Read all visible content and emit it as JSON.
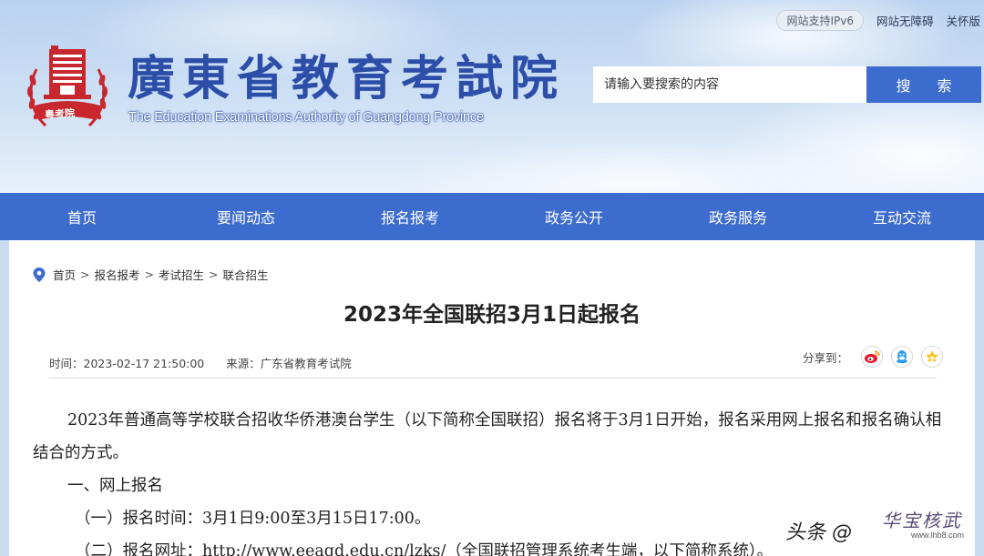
{
  "header": {
    "seal_text": "粤考院",
    "title": "廣東省教育考試院",
    "subtitle": "The Education Examinations Authority of Guangdong Province",
    "ipv6_badge": "网站支持IPv6",
    "accessibility_link": "网站无障碍",
    "elderly_link": "关怀版",
    "search": {
      "placeholder": "请输入要搜索的内容",
      "button": "搜 索"
    }
  },
  "nav": {
    "items": [
      {
        "label": "首页"
      },
      {
        "label": "要闻动态"
      },
      {
        "label": "报名报考"
      },
      {
        "label": "政务公开"
      },
      {
        "label": "政务服务"
      },
      {
        "label": "互动交流"
      }
    ]
  },
  "breadcrumb": {
    "items": [
      "首页",
      "报名报考",
      "考试招生",
      "联合招生"
    ],
    "separator": ">"
  },
  "article": {
    "title": "2023年全国联招3月1日起报名",
    "time": "时间：2023-02-17 21:50:00",
    "source": "来源：广东省教育考试院",
    "share_label": "分享到：",
    "share_icons": [
      "weibo-icon",
      "qq-icon",
      "qzone-icon"
    ],
    "paragraphs": {
      "intro": "2023年普通高等学校联合招收华侨港澳台学生（以下简称全国联招）报名将于3月1日开始，报名采用网上报名和报名确认相结合的方式。",
      "heading1": "一、网上报名",
      "item1": "（一）报名时间：3月1日9:00至3月15日17:00。",
      "item2": "（二）报名网址：http://www.eeagd.edu.cn/lzks/（全国联招管理系统考生端，以下简称系统）。"
    }
  },
  "watermark": {
    "text": "头条 @",
    "stamp_text": "华宝核武",
    "stamp_url": "www.lhb8.com"
  },
  "colors": {
    "brand_blue": "#3d6ccf",
    "title_blue": "#2d4ea8",
    "seal_red": "#c8282d"
  }
}
